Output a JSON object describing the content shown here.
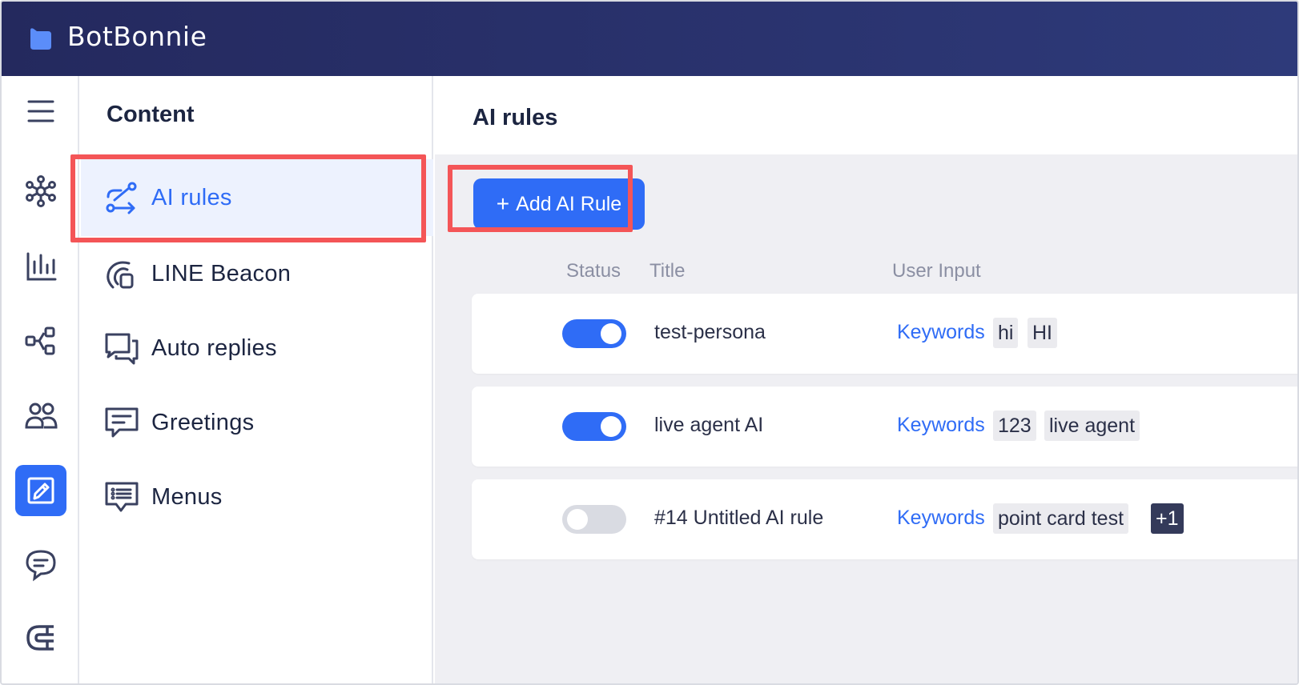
{
  "app": {
    "brand": "BotBonnie"
  },
  "colors": {
    "topbar": "#2a3370",
    "accent": "#2f6cf6",
    "highlight": "#f45557"
  },
  "rail": {
    "items": [
      {
        "icon": "hamburger-icon"
      },
      {
        "icon": "network-icon"
      },
      {
        "icon": "bar-chart-icon"
      },
      {
        "icon": "flow-icon"
      },
      {
        "icon": "users-icon"
      },
      {
        "icon": "content-edit-icon",
        "active": true
      },
      {
        "icon": "chat-bubble-icon"
      },
      {
        "icon": "magnet-icon"
      }
    ]
  },
  "panel": {
    "title": "Content",
    "items": [
      {
        "label": "AI rules",
        "icon": "ai-route-icon",
        "active": true
      },
      {
        "label": "LINE Beacon",
        "icon": "beacon-icon"
      },
      {
        "label": "Auto replies",
        "icon": "auto-reply-icon"
      },
      {
        "label": "Greetings",
        "icon": "greeting-icon"
      },
      {
        "label": "Menus",
        "icon": "menu-list-icon"
      }
    ]
  },
  "main": {
    "title": "AI rules",
    "add_button": "Add AI Rule",
    "add_button_icon": "plus-icon",
    "columns": {
      "status": "Status",
      "title": "Title",
      "user_input": "User Input"
    },
    "rules": [
      {
        "enabled": true,
        "title": "test-persona",
        "input_type": "Keywords",
        "tags": [
          "hi",
          "HI"
        ],
        "more": ""
      },
      {
        "enabled": true,
        "title": "live agent AI",
        "input_type": "Keywords",
        "tags": [
          "123",
          "live agent"
        ],
        "more": ""
      },
      {
        "enabled": false,
        "title": "#14 Untitled AI rule",
        "input_type": "Keywords",
        "tags": [
          "point card test"
        ],
        "more": "+1"
      }
    ]
  }
}
